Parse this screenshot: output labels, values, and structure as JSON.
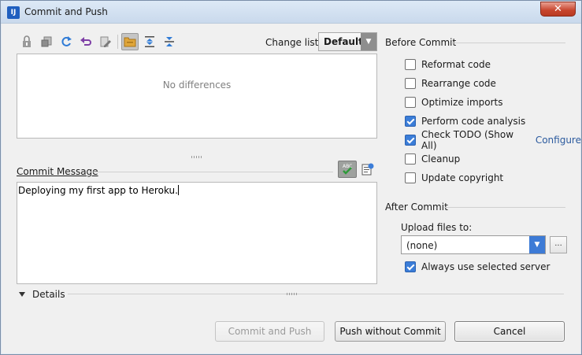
{
  "window": {
    "title": "Commit and Push",
    "close_symbol": "✕"
  },
  "toolbar": {
    "icons": [
      "lock-icon",
      "move-to-changelist-icon",
      "refresh-icon",
      "revert-icon",
      "edit-icon",
      "group-by-directory-icon",
      "expand-all-icon",
      "collapse-all-icon"
    ],
    "changelist_label": "Change list:",
    "changelist_value": "Default"
  },
  "diff": {
    "empty_text": "No differences"
  },
  "commit": {
    "label": "Commit Message",
    "message": "Deploying my first app to Heroku."
  },
  "before_commit": {
    "title": "Before Commit",
    "options": [
      {
        "label": "Reformat code",
        "checked": false
      },
      {
        "label": "Rearrange code",
        "checked": false
      },
      {
        "label": "Optimize imports",
        "checked": false
      },
      {
        "label": "Perform code analysis",
        "checked": true
      },
      {
        "label": "Check TODO (Show All)",
        "checked": true,
        "link": "Configure"
      },
      {
        "label": "Cleanup",
        "checked": false
      },
      {
        "label": "Update copyright",
        "checked": false
      }
    ]
  },
  "after_commit": {
    "title": "After Commit",
    "upload_label": "Upload files to:",
    "upload_value": "(none)",
    "browse_label": "...",
    "always_use_label": "Always use selected server",
    "always_use_checked": true
  },
  "details": {
    "label": "Details"
  },
  "buttons": {
    "commit_and_push": "Commit and Push",
    "push_without_commit": "Push without Commit",
    "cancel": "Cancel"
  },
  "colors": {
    "accent": "#3b7dd8",
    "link": "#2b5a9e",
    "close": "#c7452d",
    "check_green": "#2e9a3a"
  }
}
